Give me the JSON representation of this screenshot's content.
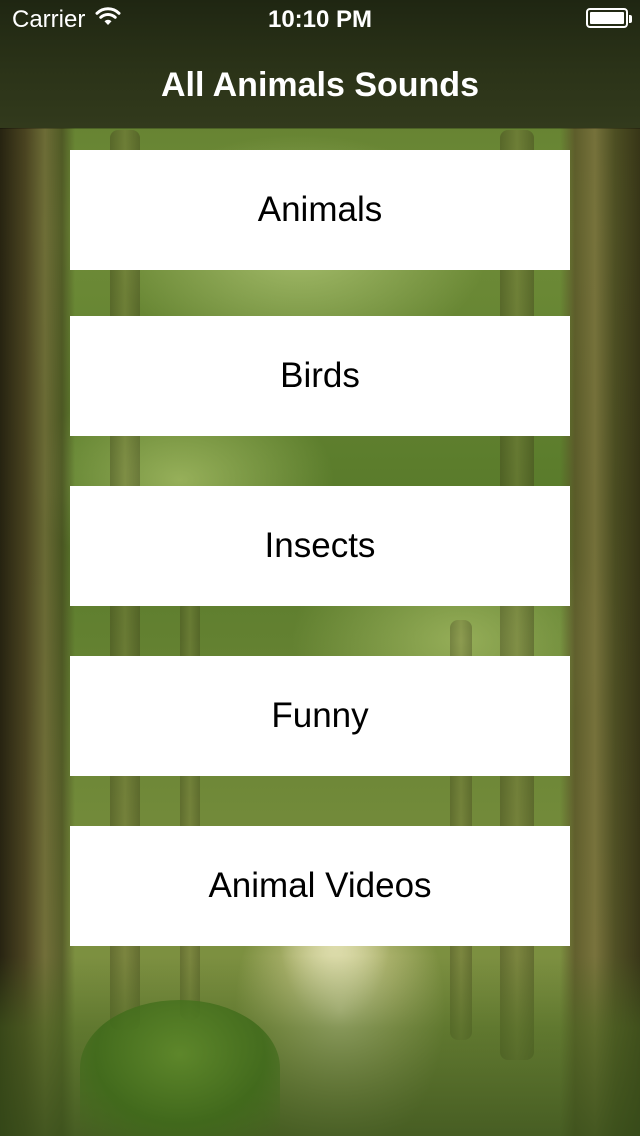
{
  "status_bar": {
    "carrier": "Carrier",
    "time": "10:10 PM",
    "wifi_icon": "wifi-icon",
    "battery_icon": "battery-icon",
    "battery_level": 1.0
  },
  "nav": {
    "title": "All Animals Sounds"
  },
  "menu": {
    "items": [
      {
        "label": "Animals"
      },
      {
        "label": "Birds"
      },
      {
        "label": "Insects"
      },
      {
        "label": "Funny"
      },
      {
        "label": "Animal Videos"
      }
    ]
  },
  "colors": {
    "nav_background": "#2b3318",
    "button_background": "#ffffff",
    "button_text": "#000000",
    "title_text": "#ffffff"
  }
}
